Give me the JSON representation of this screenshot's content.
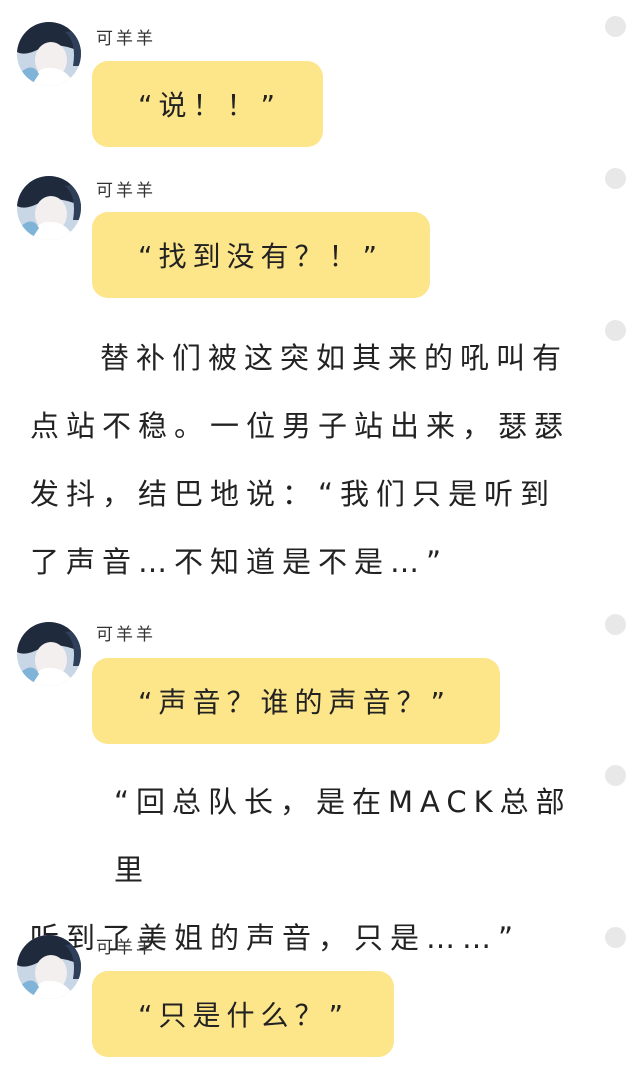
{
  "author_name": "可羊羊",
  "messages": [
    {
      "type": "chat",
      "author": "可羊羊",
      "text": "“说！！”"
    },
    {
      "type": "chat",
      "author": "可羊羊",
      "text": "“找到没有？！”"
    },
    {
      "type": "narration",
      "lines": [
        "替补们被这突如其来的吼叫有",
        "点站不稳。一位男子站出来，瑟瑟",
        "发抖，结巴地说：“我们只是听到",
        "了声音…不知道是不是…”"
      ]
    },
    {
      "type": "chat",
      "author": "可羊羊",
      "text": "“声音？谁的声音？”"
    },
    {
      "type": "narration",
      "lines": [
        "“回总队长，是在MACK总部里",
        "听到了美姐的声音，只是……”"
      ]
    },
    {
      "type": "chat",
      "author": "可羊羊",
      "text": "“只是什么？”"
    }
  ],
  "colors": {
    "bubble": "#fde58a",
    "dot": "#e8e8e8",
    "text": "#222222"
  }
}
